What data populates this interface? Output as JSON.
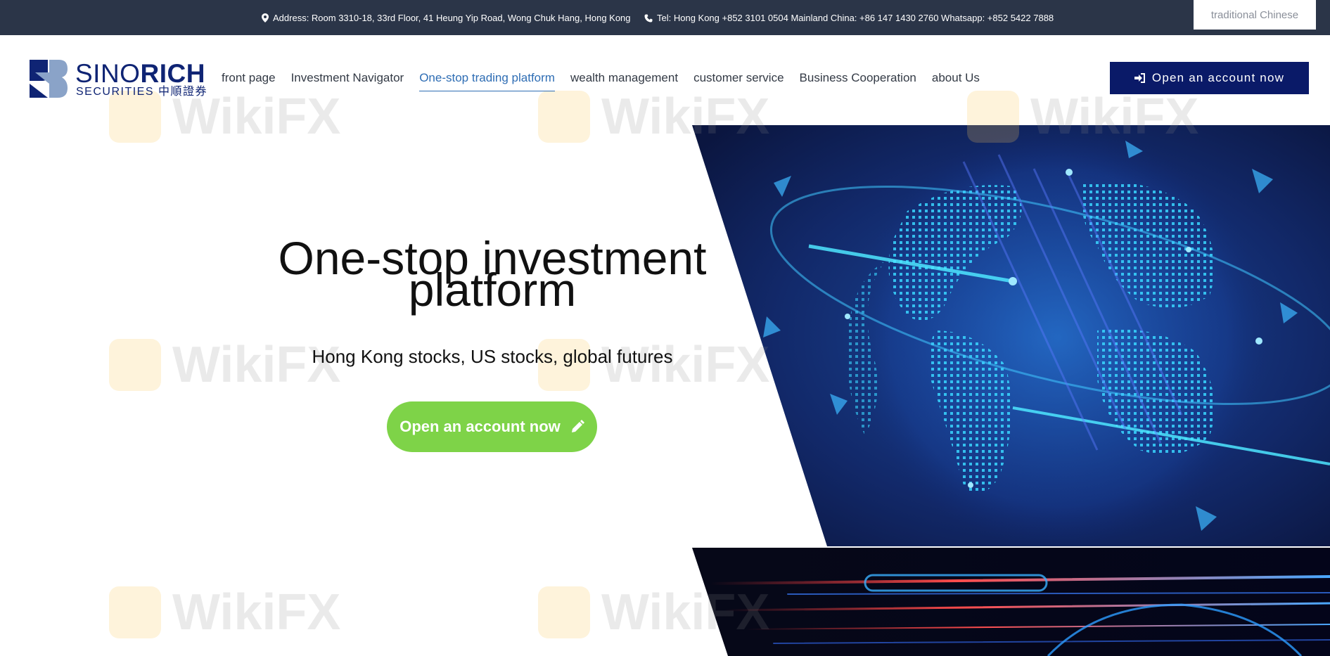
{
  "topbar": {
    "address": "Address: Room 3310-18, 33rd Floor, 41 Heung Yip Road, Wong Chuk Hang, Hong Kong",
    "tel": "Tel: Hong Kong +852 3101 0504 Mainland China: +86 147 1430 2760 Whatsapp: +852 5422 7888",
    "language": "traditional Chinese"
  },
  "logo": {
    "brand_light": "SINO",
    "brand_bold": "RICH",
    "sub": "SECURITIES 中順證券"
  },
  "nav": {
    "items": [
      {
        "label": "front page"
      },
      {
        "label": "Investment Navigator"
      },
      {
        "label": "One-stop trading platform"
      },
      {
        "label": "wealth management"
      },
      {
        "label": "customer service"
      },
      {
        "label": "Business Cooperation"
      },
      {
        "label": "about Us"
      }
    ],
    "active_index": 2
  },
  "header": {
    "open_account_label": "Open an account now"
  },
  "hero": {
    "title_line1": "One-stop investment",
    "title_line2": "platform",
    "subtitle": "Hong Kong stocks, US stocks, global futures",
    "button_label": "Open an account now"
  },
  "watermark": "WikiFX",
  "colors": {
    "topbar_bg": "#2b3548",
    "brand_navy": "#0a1a68",
    "nav_active": "#2e6db4",
    "cta_green": "#7ed348"
  },
  "icons": {
    "address": "map-pin-icon",
    "tel": "phone-icon",
    "open_account": "sign-in-icon",
    "hero_button": "pencil-icon"
  }
}
